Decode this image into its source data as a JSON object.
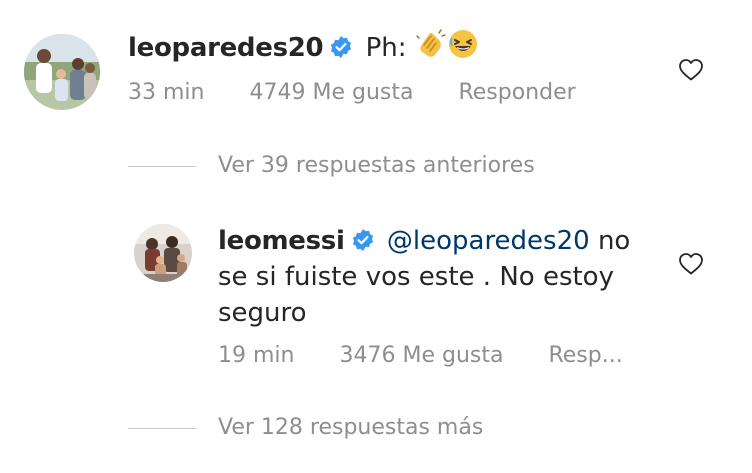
{
  "comment1": {
    "username": "leoparedes20",
    "text": "Ph:",
    "emojis": [
      "clapping-hands",
      "grinning-squinting-face"
    ],
    "time": "33 min",
    "likes": "4749 Me gusta",
    "reply_label": "Responder"
  },
  "view_previous": "Ver 39 respuestas anteriores",
  "comment2": {
    "username": "leomessi",
    "mention": "@leoparedes20",
    "text_line1_tail": " no",
    "text_line2": "se si fuiste vos este . No estoy",
    "text_line3": "seguro",
    "time": "19 min",
    "likes": "3476 Me gusta",
    "reply_label": "Resp..."
  },
  "view_more": "Ver 128 respuestas más",
  "icons": {
    "verified": "verified-badge-icon",
    "like": "heart-outline-icon"
  },
  "colors": {
    "verified_blue": "#3897f0",
    "mention": "#00376b",
    "secondary_text": "#8e8e8e",
    "primary_text": "#262626"
  }
}
